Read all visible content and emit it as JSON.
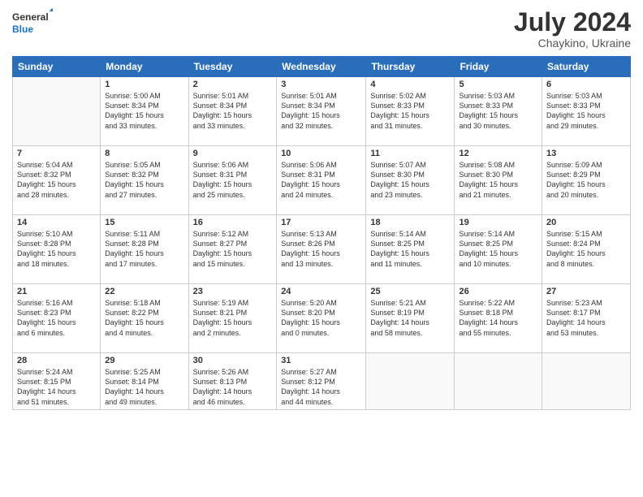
{
  "logo": {
    "line1": "General",
    "line2": "Blue"
  },
  "title": {
    "month_year": "July 2024",
    "location": "Chaykino, Ukraine"
  },
  "weekdays": [
    "Sunday",
    "Monday",
    "Tuesday",
    "Wednesday",
    "Thursday",
    "Friday",
    "Saturday"
  ],
  "weeks": [
    [
      {
        "day": null,
        "info": null
      },
      {
        "day": "1",
        "info": "Sunrise: 5:00 AM\nSunset: 8:34 PM\nDaylight: 15 hours\nand 33 minutes."
      },
      {
        "day": "2",
        "info": "Sunrise: 5:01 AM\nSunset: 8:34 PM\nDaylight: 15 hours\nand 33 minutes."
      },
      {
        "day": "3",
        "info": "Sunrise: 5:01 AM\nSunset: 8:34 PM\nDaylight: 15 hours\nand 32 minutes."
      },
      {
        "day": "4",
        "info": "Sunrise: 5:02 AM\nSunset: 8:33 PM\nDaylight: 15 hours\nand 31 minutes."
      },
      {
        "day": "5",
        "info": "Sunrise: 5:03 AM\nSunset: 8:33 PM\nDaylight: 15 hours\nand 30 minutes."
      },
      {
        "day": "6",
        "info": "Sunrise: 5:03 AM\nSunset: 8:33 PM\nDaylight: 15 hours\nand 29 minutes."
      }
    ],
    [
      {
        "day": "7",
        "info": "Sunrise: 5:04 AM\nSunset: 8:32 PM\nDaylight: 15 hours\nand 28 minutes."
      },
      {
        "day": "8",
        "info": "Sunrise: 5:05 AM\nSunset: 8:32 PM\nDaylight: 15 hours\nand 27 minutes."
      },
      {
        "day": "9",
        "info": "Sunrise: 5:06 AM\nSunset: 8:31 PM\nDaylight: 15 hours\nand 25 minutes."
      },
      {
        "day": "10",
        "info": "Sunrise: 5:06 AM\nSunset: 8:31 PM\nDaylight: 15 hours\nand 24 minutes."
      },
      {
        "day": "11",
        "info": "Sunrise: 5:07 AM\nSunset: 8:30 PM\nDaylight: 15 hours\nand 23 minutes."
      },
      {
        "day": "12",
        "info": "Sunrise: 5:08 AM\nSunset: 8:30 PM\nDaylight: 15 hours\nand 21 minutes."
      },
      {
        "day": "13",
        "info": "Sunrise: 5:09 AM\nSunset: 8:29 PM\nDaylight: 15 hours\nand 20 minutes."
      }
    ],
    [
      {
        "day": "14",
        "info": "Sunrise: 5:10 AM\nSunset: 8:28 PM\nDaylight: 15 hours\nand 18 minutes."
      },
      {
        "day": "15",
        "info": "Sunrise: 5:11 AM\nSunset: 8:28 PM\nDaylight: 15 hours\nand 17 minutes."
      },
      {
        "day": "16",
        "info": "Sunrise: 5:12 AM\nSunset: 8:27 PM\nDaylight: 15 hours\nand 15 minutes."
      },
      {
        "day": "17",
        "info": "Sunrise: 5:13 AM\nSunset: 8:26 PM\nDaylight: 15 hours\nand 13 minutes."
      },
      {
        "day": "18",
        "info": "Sunrise: 5:14 AM\nSunset: 8:25 PM\nDaylight: 15 hours\nand 11 minutes."
      },
      {
        "day": "19",
        "info": "Sunrise: 5:14 AM\nSunset: 8:25 PM\nDaylight: 15 hours\nand 10 minutes."
      },
      {
        "day": "20",
        "info": "Sunrise: 5:15 AM\nSunset: 8:24 PM\nDaylight: 15 hours\nand 8 minutes."
      }
    ],
    [
      {
        "day": "21",
        "info": "Sunrise: 5:16 AM\nSunset: 8:23 PM\nDaylight: 15 hours\nand 6 minutes."
      },
      {
        "day": "22",
        "info": "Sunrise: 5:18 AM\nSunset: 8:22 PM\nDaylight: 15 hours\nand 4 minutes."
      },
      {
        "day": "23",
        "info": "Sunrise: 5:19 AM\nSunset: 8:21 PM\nDaylight: 15 hours\nand 2 minutes."
      },
      {
        "day": "24",
        "info": "Sunrise: 5:20 AM\nSunset: 8:20 PM\nDaylight: 15 hours\nand 0 minutes."
      },
      {
        "day": "25",
        "info": "Sunrise: 5:21 AM\nSunset: 8:19 PM\nDaylight: 14 hours\nand 58 minutes."
      },
      {
        "day": "26",
        "info": "Sunrise: 5:22 AM\nSunset: 8:18 PM\nDaylight: 14 hours\nand 55 minutes."
      },
      {
        "day": "27",
        "info": "Sunrise: 5:23 AM\nSunset: 8:17 PM\nDaylight: 14 hours\nand 53 minutes."
      }
    ],
    [
      {
        "day": "28",
        "info": "Sunrise: 5:24 AM\nSunset: 8:15 PM\nDaylight: 14 hours\nand 51 minutes."
      },
      {
        "day": "29",
        "info": "Sunrise: 5:25 AM\nSunset: 8:14 PM\nDaylight: 14 hours\nand 49 minutes."
      },
      {
        "day": "30",
        "info": "Sunrise: 5:26 AM\nSunset: 8:13 PM\nDaylight: 14 hours\nand 46 minutes."
      },
      {
        "day": "31",
        "info": "Sunrise: 5:27 AM\nSunset: 8:12 PM\nDaylight: 14 hours\nand 44 minutes."
      },
      {
        "day": null,
        "info": null
      },
      {
        "day": null,
        "info": null
      },
      {
        "day": null,
        "info": null
      }
    ]
  ]
}
